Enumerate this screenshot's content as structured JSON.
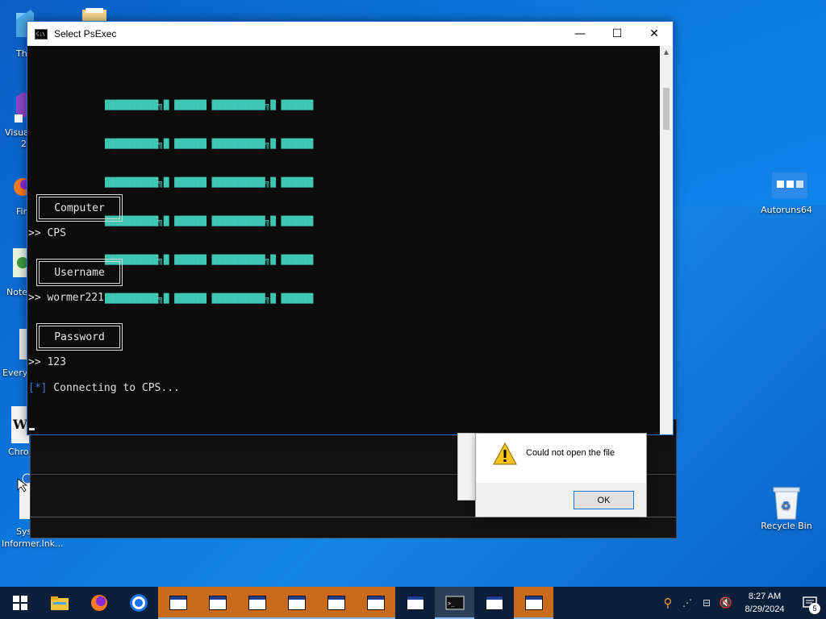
{
  "window": {
    "title": "Select PsExec",
    "min_glyph": "—",
    "max_glyph": "☐",
    "close_glyph": "✕"
  },
  "console": {
    "banner_lines": [
      "██████████╗█ ██████ ██████████╗█ ██████",
      "██████████╗█ ██████ ██████████╗█ ██████",
      "██████████╗█ ██████ ██████████╗█ ██████",
      "██████████╗█ ██████ ██████████╗█ ██████",
      "██████████╗█ ██████ ██████████╗█ ██████",
      "██████████╗█ ██████ ██████████╗█ ██████"
    ],
    "sections": [
      {
        "label": "Computer",
        "value": ">> CPS"
      },
      {
        "label": "Username",
        "value": ">> wormer221"
      },
      {
        "label": "Password",
        "value": ">> 123"
      }
    ],
    "status_prefix": "[*]",
    "status_text": " Connecting to CPS...",
    "status_color": "#3a78d6",
    "banner_color": "#3fc7b4"
  },
  "dialog": {
    "message": "Could not open the file",
    "ok_label": "OK"
  },
  "desktop": {
    "right_icons": [
      {
        "label": "Autoruns64",
        "icon": "autoruns-icon"
      },
      {
        "label": "Recycle Bin",
        "icon": "recycle-bin-icon"
      }
    ],
    "left_labels": [
      "Th",
      "Visua",
      "2",
      "Fir",
      "Note",
      "Every",
      "Chro",
      "Syst",
      "Informer.lnk..."
    ]
  },
  "taskbar": {
    "clock_time": "8:27 AM",
    "clock_date": "8/29/2024",
    "notification_count": "5",
    "accent": "#c96b1c"
  }
}
